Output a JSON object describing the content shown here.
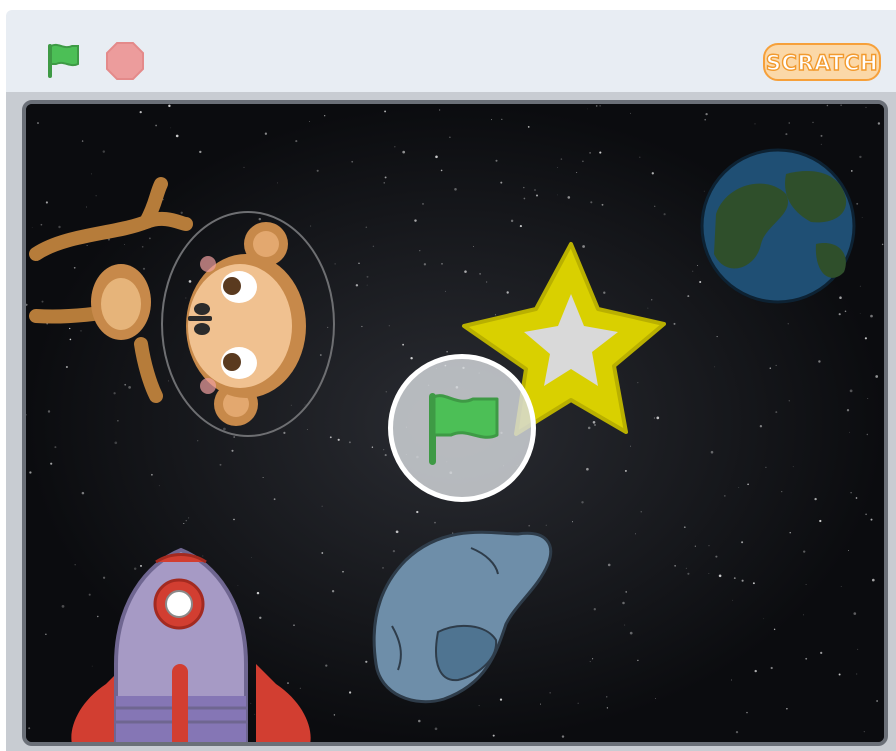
{
  "header": {
    "green_flag_icon": "green-flag-icon",
    "stop_icon": "stop-icon",
    "logo_text": "SCRATCH"
  },
  "stage": {
    "sprites": [
      "monkey",
      "star",
      "planet",
      "rocket",
      "rock"
    ],
    "overlay_icon": "green-flag-icon"
  },
  "colors": {
    "header_bg": "#e8edf3",
    "flag_green": "#4cbf56",
    "stop_red": "#ec9c9c",
    "logo_orange": "#f6a03a"
  }
}
